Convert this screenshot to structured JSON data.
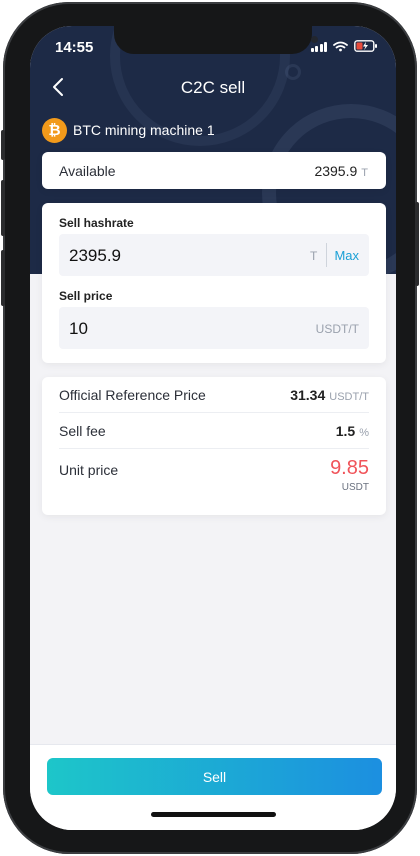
{
  "status": {
    "time": "14:55"
  },
  "header": {
    "title": "C2C sell",
    "back_icon": "chevron-left-icon"
  },
  "asset": {
    "coin_icon": "bitcoin-icon",
    "coin_symbol": "₿",
    "name": "BTC mining machine 1"
  },
  "available": {
    "label": "Available",
    "value": "2395.9",
    "unit": "T"
  },
  "form": {
    "hashrate": {
      "label": "Sell hashrate",
      "value": "2395.9",
      "unit": "T",
      "max_label": "Max"
    },
    "price": {
      "label": "Sell price",
      "value": "10",
      "unit": "USDT/T"
    }
  },
  "summary": {
    "reference": {
      "label": "Official Reference Price",
      "value": "31.34",
      "unit": "USDT/T"
    },
    "fee": {
      "label": "Sell fee",
      "value": "1.5",
      "unit": "%"
    },
    "unit_price": {
      "label": "Unit price",
      "value": "9.85",
      "unit": "USDT"
    }
  },
  "footer": {
    "sell_label": "Sell"
  },
  "colors": {
    "header_bg": "#1d2a46",
    "accent": "#1aa0d6",
    "price_red": "#f0545a",
    "btn_from": "#1dc6c9",
    "btn_to": "#1c8fe0",
    "coin": "#f29a1b"
  }
}
